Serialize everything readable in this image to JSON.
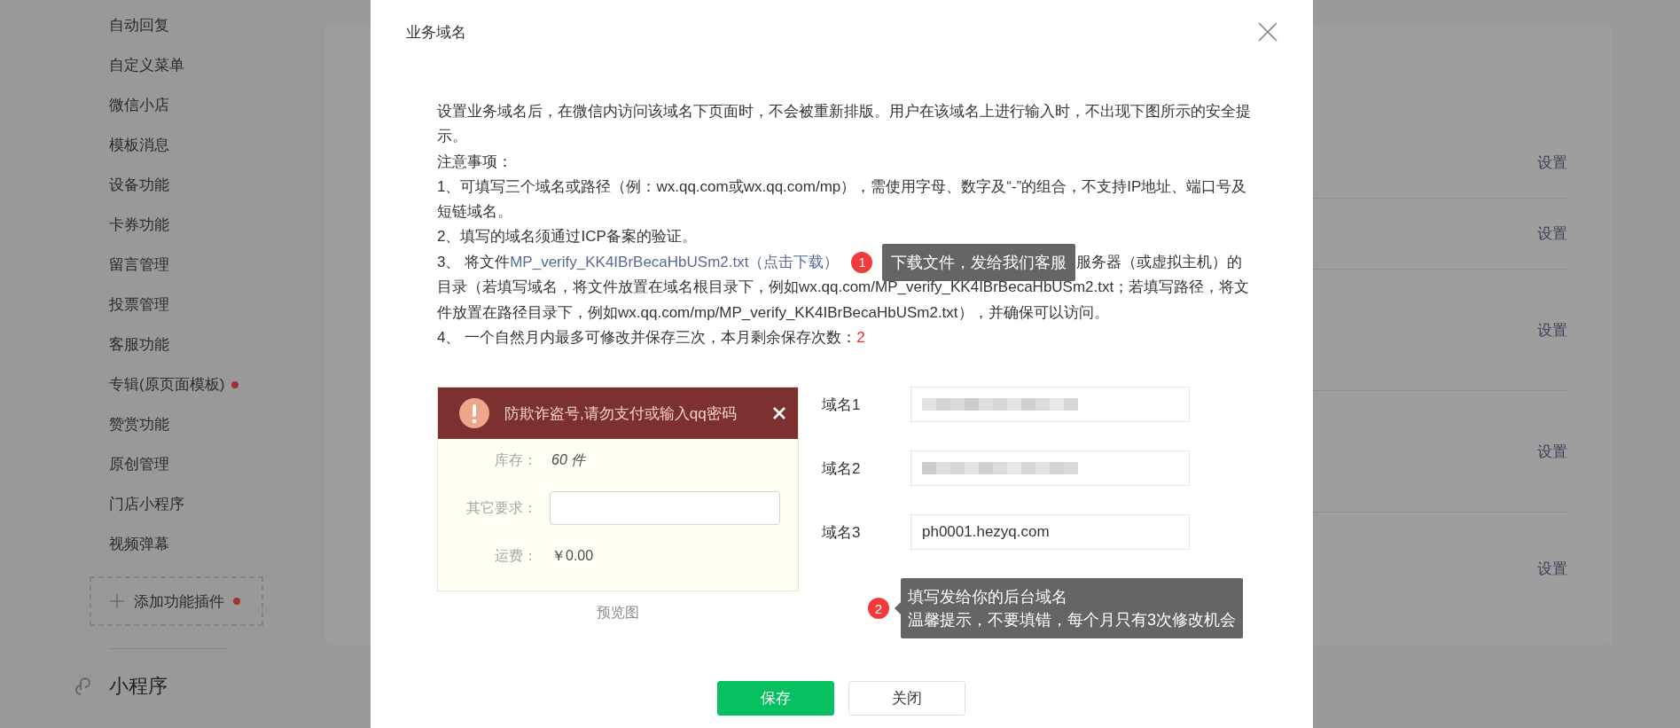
{
  "sidebar": {
    "items": [
      {
        "label": "自动回复",
        "dot": false
      },
      {
        "label": "自定义菜单",
        "dot": false
      },
      {
        "label": "微信小店",
        "dot": false
      },
      {
        "label": "模板消息",
        "dot": false
      },
      {
        "label": "设备功能",
        "dot": false
      },
      {
        "label": "卡券功能",
        "dot": false
      },
      {
        "label": "留言管理",
        "dot": false
      },
      {
        "label": "投票管理",
        "dot": false
      },
      {
        "label": "客服功能",
        "dot": false
      },
      {
        "label": "专辑(原页面模板)",
        "dot": true
      },
      {
        "label": "赞赏功能",
        "dot": false
      },
      {
        "label": "原创管理",
        "dot": false
      },
      {
        "label": "门店小程序",
        "dot": false
      },
      {
        "label": "视频弹幕",
        "dot": false
      }
    ],
    "add_plugin": {
      "label": "添加功能插件",
      "dot": true
    },
    "section": {
      "title": "小程序"
    }
  },
  "content": {
    "setting_links": [
      "设置",
      "设置",
      "设置",
      "设置",
      "设置"
    ]
  },
  "dialog": {
    "title": "业务域名",
    "intro": "设置业务域名后，在微信内访问该域名下页面时，不会被重新排版。用户在该域名上进行输入时，不出现下图所示的安全提示。",
    "notes_title": "注意事项：",
    "notes": [
      {
        "kind": "plain",
        "text": "1、可填写三个域名或路径（例：wx.qq.com或wx.qq.com/mp），需使用字母、数字及“-”的组合，不支持IP地址、端口号及短链域名。"
      },
      {
        "kind": "plain",
        "text": "2、填写的域名须通过ICP备案的验证。"
      },
      {
        "kind": "download",
        "prefix": "3、 将文件",
        "link": "MP_verify_KK4IBrBecaHbUSm2.txt（点击下载）",
        "tip": {
          "number": "1",
          "text": "下载文件，发给我们客服"
        },
        "suffix": "服务器（或虚拟主机）的目录（若填写域名，将文件放置在域名根目录下，例如wx.qq.com/MP_verify_KK4IBrBecaHbUSm2.txt；若填写路径，将文件放置在路径目录下，例如wx.qq.com/mp/MP_verify_KK4IBrBecaHbUSm2.txt），并确保可以访问。"
      },
      {
        "kind": "count",
        "text": "4、 一个自然月内最多可修改并保存三次，本月剩余保存次数：",
        "count": "2"
      }
    ],
    "preview": {
      "banner": "防欺诈盗号,请勿支付或输入qq密码",
      "rows": [
        {
          "kind": "value",
          "label": "库存：",
          "value": "60 件"
        },
        {
          "kind": "input",
          "label": "其它要求："
        },
        {
          "kind": "value",
          "label": "运费：",
          "value": "￥0.00"
        }
      ],
      "caption": "预览图"
    },
    "domains": [
      {
        "label": "域名1",
        "redacted": true
      },
      {
        "label": "域名2",
        "redacted": true
      },
      {
        "label": "域名3",
        "redacted": false,
        "value": "ph0001.hezyq.com"
      }
    ],
    "tip": {
      "number": "2",
      "lines": [
        "填写发给你的后台域名",
        "温馨提示，不要填错，每个月只有3次修改机会"
      ]
    },
    "buttons": [
      {
        "label": "保存",
        "kind": "primary"
      },
      {
        "label": "关闭",
        "kind": "default"
      }
    ]
  }
}
